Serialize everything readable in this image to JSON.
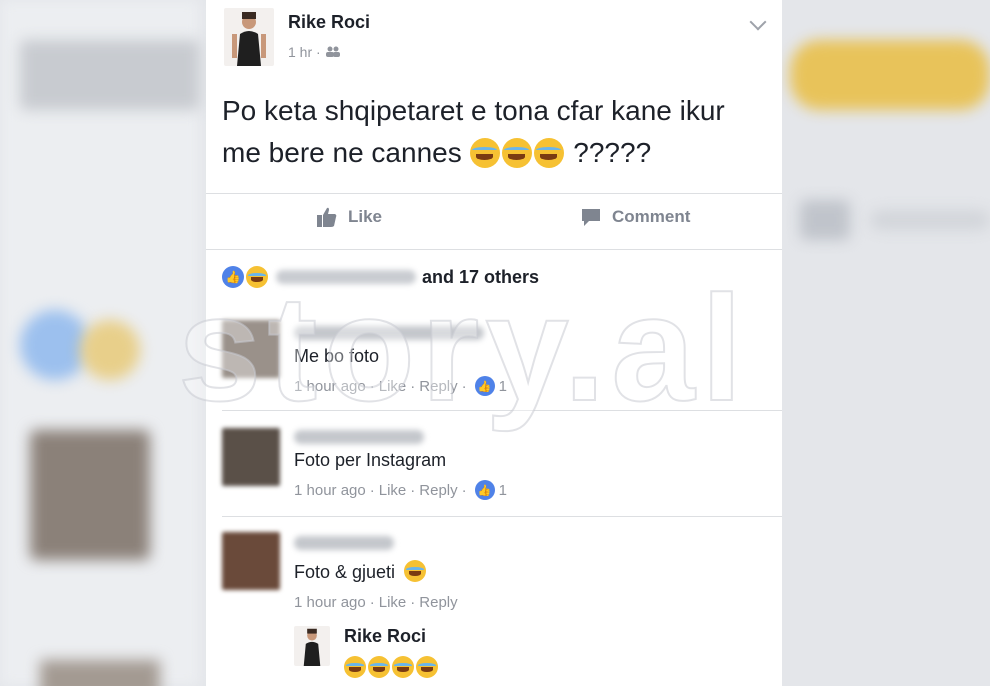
{
  "post": {
    "author": "Rike Roci",
    "time": "1 hr",
    "audience_icon": "friends-icon",
    "text": "Po keta shqipetaret e tona cfar kane ikur me bere ne cannes",
    "text_suffix": "?????",
    "emoji_count": 3,
    "actions": {
      "like_label": "Like",
      "comment_label": "Comment"
    },
    "reactions_text": "and 17 others"
  },
  "comments": [
    {
      "text": "Me bo foto",
      "time": "1 hour ago",
      "like": "Like",
      "reply": "Reply",
      "likes": "1"
    },
    {
      "text": "Foto per Instagram",
      "time": "1 hour ago",
      "like": "Like",
      "reply": "Reply",
      "likes": "1"
    },
    {
      "text": "Foto & gjueti",
      "time": "1 hour ago",
      "like": "Like",
      "reply": "Reply"
    }
  ],
  "reply": {
    "author": "Rike Roci",
    "emoji_count": 4
  },
  "watermark": "story.al",
  "colors": {
    "brand_blue": "#4f82e8",
    "text": "#1d2129",
    "muted": "#90949c"
  }
}
